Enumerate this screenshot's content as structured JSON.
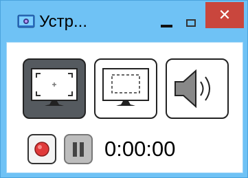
{
  "window": {
    "title": "Устр...",
    "icon": "screen-recorder-app-icon",
    "controls": {
      "minimize_icon": "minimize-icon",
      "maximize_icon": "maximize-icon",
      "close_glyph": "✕"
    }
  },
  "modes": [
    {
      "name": "fullscreen",
      "icon": "fullscreen-capture-icon",
      "selected": true
    },
    {
      "name": "region",
      "icon": "region-capture-icon",
      "selected": false
    },
    {
      "name": "audio",
      "icon": "speaker-icon",
      "selected": false
    }
  ],
  "recording": {
    "record_icon": "record-icon",
    "pause_icon": "pause-icon",
    "time": "0:00:00"
  },
  "colors": {
    "frame": "#6fc2f5",
    "close_button": "#c9463d",
    "selected_mode": "#555a5f",
    "record_dot": "#e03a3a"
  }
}
